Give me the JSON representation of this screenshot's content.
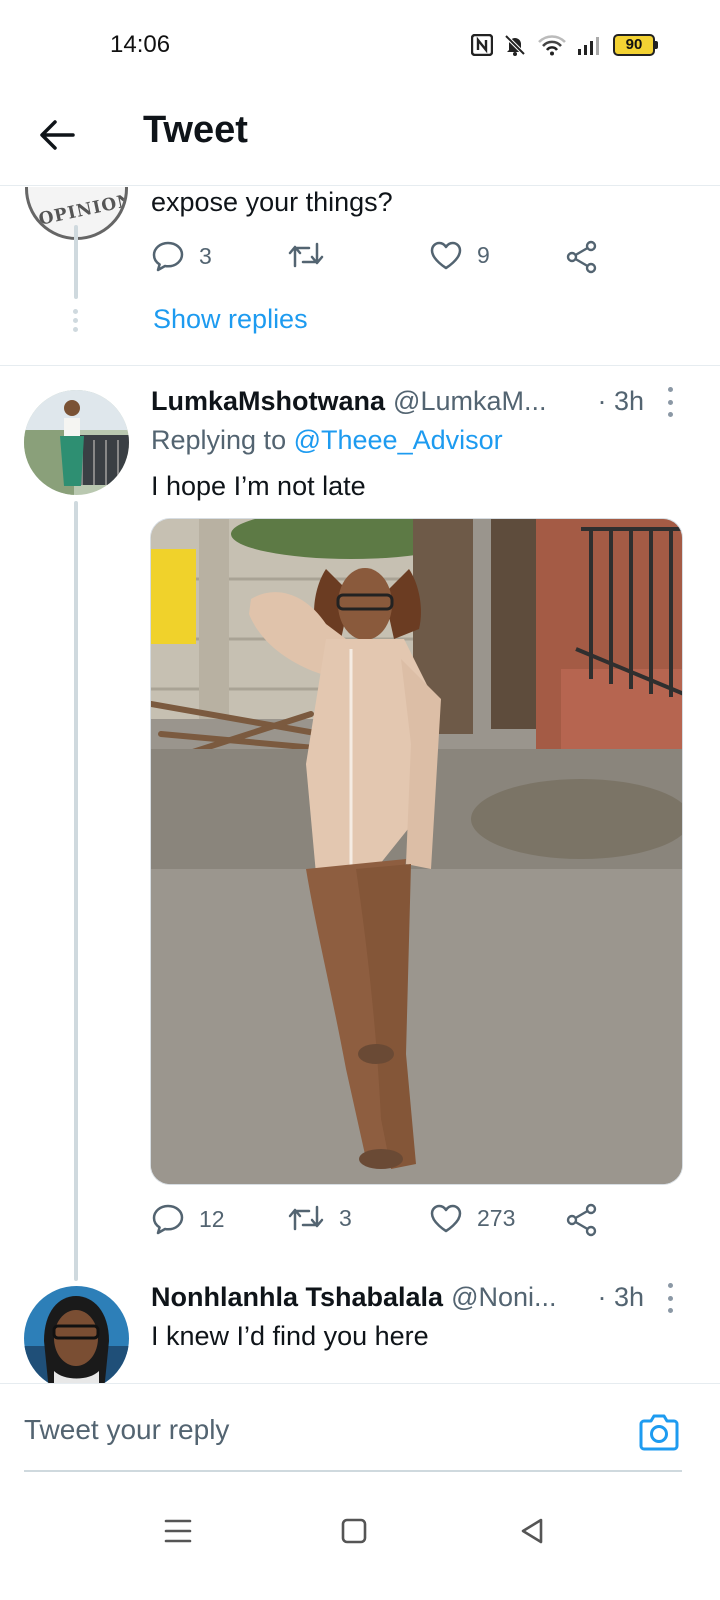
{
  "status_bar": {
    "time": "14:06",
    "battery": "90"
  },
  "header": {
    "title": "Tweet"
  },
  "prev_tweet": {
    "avatar_text": "OPINION",
    "text": "expose your things?",
    "replies": "3",
    "retweets": "",
    "likes": "9",
    "show_replies": "Show replies"
  },
  "tweet1": {
    "display_name": "LumkaMshotwana",
    "handle": "@LumkaM...",
    "time": "· 3h",
    "replying_prefix": "Replying to",
    "replying_to": "@Theee_Advisor",
    "text": "I hope I’m not late",
    "replies": "12",
    "retweets": "3",
    "likes": "273"
  },
  "tweet2": {
    "display_name": "Nonhlanhla Tshabalala",
    "handle": "@Noni...",
    "time": "· 3h",
    "text": "I knew I’d find you here"
  },
  "reply_bar": {
    "placeholder": "Tweet your reply"
  },
  "colors": {
    "accent": "#1d9bf0",
    "muted": "#536471",
    "text": "#0f1419"
  },
  "icons": [
    "back-arrow-icon",
    "reply-icon",
    "retweet-icon",
    "like-icon",
    "share-icon",
    "camera-icon",
    "more-icon"
  ]
}
